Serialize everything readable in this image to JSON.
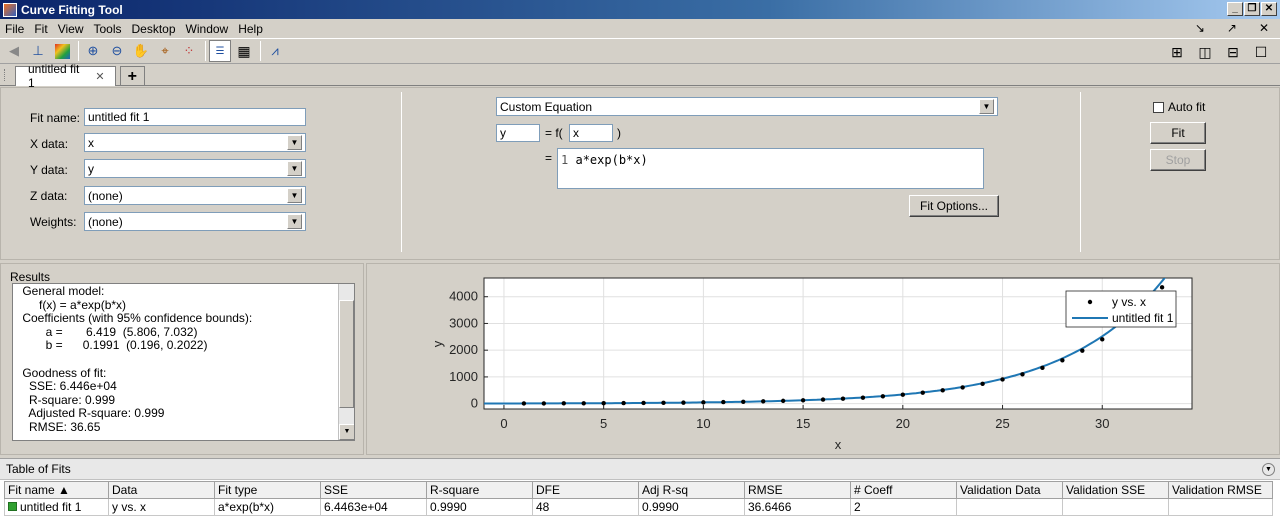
{
  "window": {
    "title": "Curve Fitting Tool"
  },
  "menu": [
    "File",
    "Fit",
    "View",
    "Tools",
    "Desktop",
    "Window",
    "Help"
  ],
  "tabs": [
    {
      "label": "untitled fit 1"
    }
  ],
  "fit_setup": {
    "fit_name_label": "Fit name:",
    "fit_name_value": "untitled fit 1",
    "x_data_label": "X data:",
    "x_data_value": "x",
    "y_data_label": "Y data:",
    "y_data_value": "y",
    "z_data_label": "Z data:",
    "z_data_value": "(none)",
    "weights_label": "Weights:",
    "weights_value": "(none)"
  },
  "equation": {
    "type": "Custom Equation",
    "lhs": "y",
    "eq_f": "= f(",
    "var": "x",
    "close": ")",
    "eq": "=",
    "line_number": "1",
    "expression": "a*exp(b*x)",
    "fit_options_label": "Fit Options..."
  },
  "controls": {
    "auto_fit_label": "Auto fit",
    "auto_fit_checked": false,
    "fit_label": "Fit",
    "stop_label": "Stop"
  },
  "results": {
    "title": "Results",
    "lines": [
      " General model:",
      "      f(x) = a*exp(b*x)",
      " Coefficients (with 95% confidence bounds):",
      "        a =       6.419  (5.806, 7.032)",
      "        b =      0.1991  (0.196, 0.2022)",
      "",
      " Goodness of fit:",
      "   SSE: 6.446e+04",
      "   R-square: 0.999",
      "   Adjusted R-square: 0.999",
      "   RMSE: 36.65"
    ]
  },
  "chart_data": {
    "type": "scatter",
    "xlabel": "x",
    "ylabel": "y",
    "xlim": [
      -1,
      34.5
    ],
    "ylim": [
      -200,
      4700
    ],
    "xticks": [
      0,
      5,
      10,
      15,
      20,
      25,
      30
    ],
    "yticks": [
      0,
      1000,
      2000,
      3000,
      4000
    ],
    "grid": true,
    "legend_position": "top-right",
    "series": [
      {
        "name": "y vs. x",
        "kind": "points",
        "x": [
          1,
          2,
          3,
          4,
          5,
          6,
          7,
          8,
          9,
          10,
          11,
          12,
          13,
          14,
          15,
          16,
          17,
          18,
          19,
          20,
          21,
          22,
          23,
          24,
          25,
          26,
          27,
          28,
          29,
          30,
          31,
          32,
          33
        ],
        "y": [
          8,
          9,
          12,
          14,
          17,
          21,
          25,
          31,
          38,
          48,
          58,
          70,
          86,
          104,
          125,
          153,
          185,
          224,
          276,
          335,
          412,
          498,
          607,
          742,
          905,
          1097,
          1339,
          1622,
          1983,
          2405,
          2943,
          3580,
          4350
        ]
      },
      {
        "name": "untitled fit 1",
        "kind": "line",
        "model": {
          "a": 6.419,
          "b": 0.1991
        },
        "x_range": [
          -1,
          34.5
        ]
      }
    ],
    "colors": {
      "points": "#000000",
      "fit": "#1f77b4"
    }
  },
  "table_of_fits": {
    "title": "Table of Fits",
    "columns": [
      "Fit name",
      "Data",
      "Fit type",
      "SSE",
      "R-square",
      "DFE",
      "Adj R-sq",
      "RMSE",
      "# Coeff",
      "Validation Data",
      "Validation SSE",
      "Validation RMSE"
    ],
    "rows": [
      [
        "untitled fit 1",
        "y vs. x",
        "a*exp(b*x)",
        "6.4463e+04",
        "0.9990",
        "48",
        "0.9990",
        "36.6466",
        "2",
        "",
        "",
        ""
      ]
    ]
  }
}
